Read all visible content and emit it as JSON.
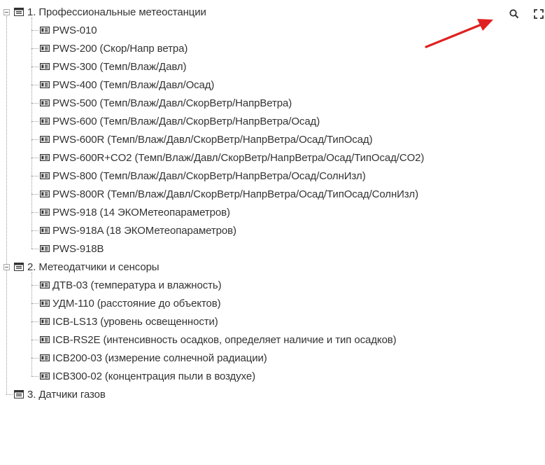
{
  "tree": {
    "groups": [
      {
        "label": "1. Профессиональные метеостанции",
        "expanded": true,
        "items": [
          "PWS-010",
          "PWS-200 (Скор/Напр ветра)",
          "PWS-300 (Темп/Влаж/Давл)",
          "PWS-400 (Темп/Влаж/Давл/Осад)",
          "PWS-500 (Темп/Влаж/Давл/СкорВетр/НапрВетра)",
          "PWS-600 (Темп/Влаж/Давл/СкорВетр/НапрВетра/Осад)",
          "PWS-600R (Темп/Влаж/Давл/СкорВетр/НапрВетра/Осад/ТипОсад)",
          "PWS-600R+CO2 (Темп/Влаж/Давл/СкорВетр/НапрВетра/Осад/ТипОсад/CO2)",
          "PWS-800 (Темп/Влаж/Давл/СкорВетр/НапрВетра/Осад/СолнИзл)",
          "PWS-800R (Темп/Влаж/Давл/СкорВетр/НапрВетра/Осад/ТипОсад/СолнИзл)",
          "PWS-918 (14 ЭКОМетеопараметров)",
          "PWS-918A (18 ЭКОМетеопараметров)",
          "PWS-918B"
        ]
      },
      {
        "label": "2. Метеодатчики и сенсоры",
        "expanded": true,
        "items": [
          "ДТВ-03 (температура и влажность)",
          "УДМ-110 (расстояние до объектов)",
          "ICB-LS13 (уровень освещенности)",
          "ICB-RS2E (интенсивность осадков, определяет наличие и тип осадков)",
          "ICB200-03 (измерение солнечной радиации)",
          "ICB300-02 (концентрация пыли в воздухе)"
        ]
      },
      {
        "label": "3. Датчики газов",
        "expanded": false,
        "items": []
      }
    ]
  },
  "toolbar": {
    "search_icon": "search-icon",
    "fullscreen_icon": "fullscreen-icon"
  },
  "icons": {
    "group": "folder-icon",
    "item": "device-icon"
  },
  "colors": {
    "text": "#333333",
    "tree_lines": "#9a9a9a",
    "arrow": "#e02020"
  }
}
